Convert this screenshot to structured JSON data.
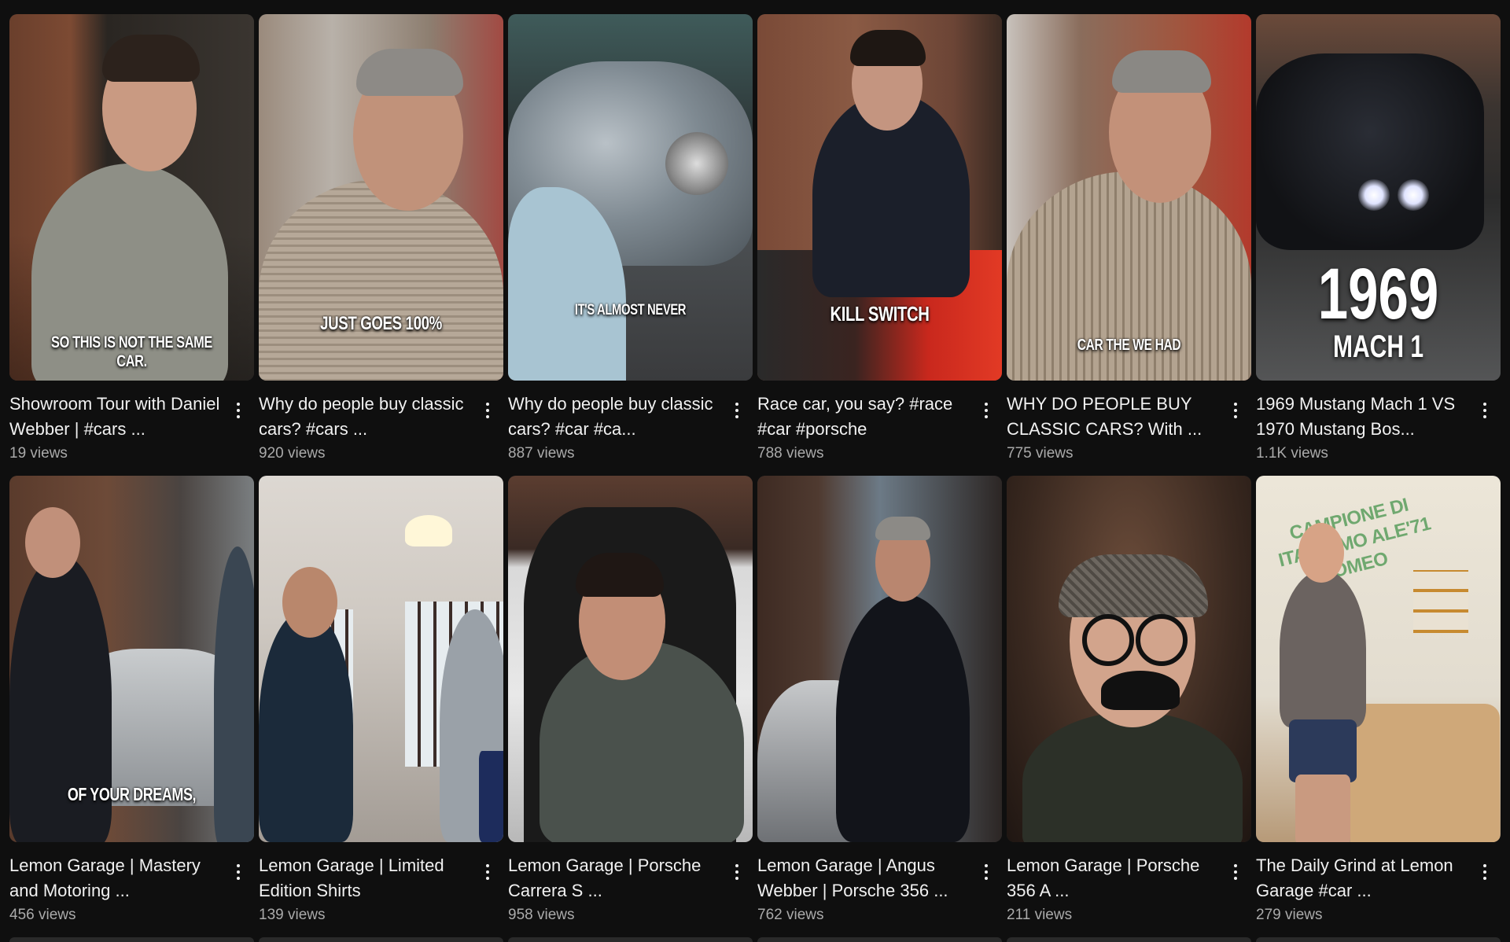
{
  "videos": [
    {
      "title": "Showroom Tour with Daniel Webber | #cars ...",
      "views": "19 views",
      "caption": "SO THIS IS NOT THE SAME CAR."
    },
    {
      "title": "Why do people buy classic cars? #cars ...",
      "views": "920 views",
      "caption": "JUST GOES 100%"
    },
    {
      "title": "Why do people buy classic cars? #car #ca...",
      "views": "887 views",
      "caption": "IT'S ALMOST NEVER"
    },
    {
      "title": "Race car, you say? #race #car #porsche",
      "views": "788 views",
      "caption": "KILL SWITCH"
    },
    {
      "title": "WHY DO PEOPLE BUY CLASSIC CARS? With ...",
      "views": "775 views",
      "caption": "CAR THE WE HAD"
    },
    {
      "title": "1969 Mustang Mach 1 VS 1970 Mustang Bos...",
      "views": "1.1K views",
      "caption_big": "1969",
      "caption_sub": "MACH 1"
    },
    {
      "title": "Lemon Garage | Mastery and Motoring ...",
      "views": "456 views",
      "caption": "OF YOUR DREAMS,"
    },
    {
      "title": "Lemon Garage | Limited Edition Shirts",
      "views": "139 views",
      "caption": ""
    },
    {
      "title": "Lemon Garage | Porsche Carrera S ...",
      "views": "958 views",
      "caption": ""
    },
    {
      "title": "Lemon Garage | Angus Webber | Porsche 356 ...",
      "views": "762 views",
      "caption": ""
    },
    {
      "title": "Lemon Garage | Porsche 356 A ...",
      "views": "211 views",
      "caption": ""
    },
    {
      "title": "The Daily Grind at Lemon Garage #car ...",
      "views": "279 views",
      "caption": "",
      "wall_text": "CAMPIONE DI ITALIA MO ALE'71 OMEO"
    }
  ]
}
